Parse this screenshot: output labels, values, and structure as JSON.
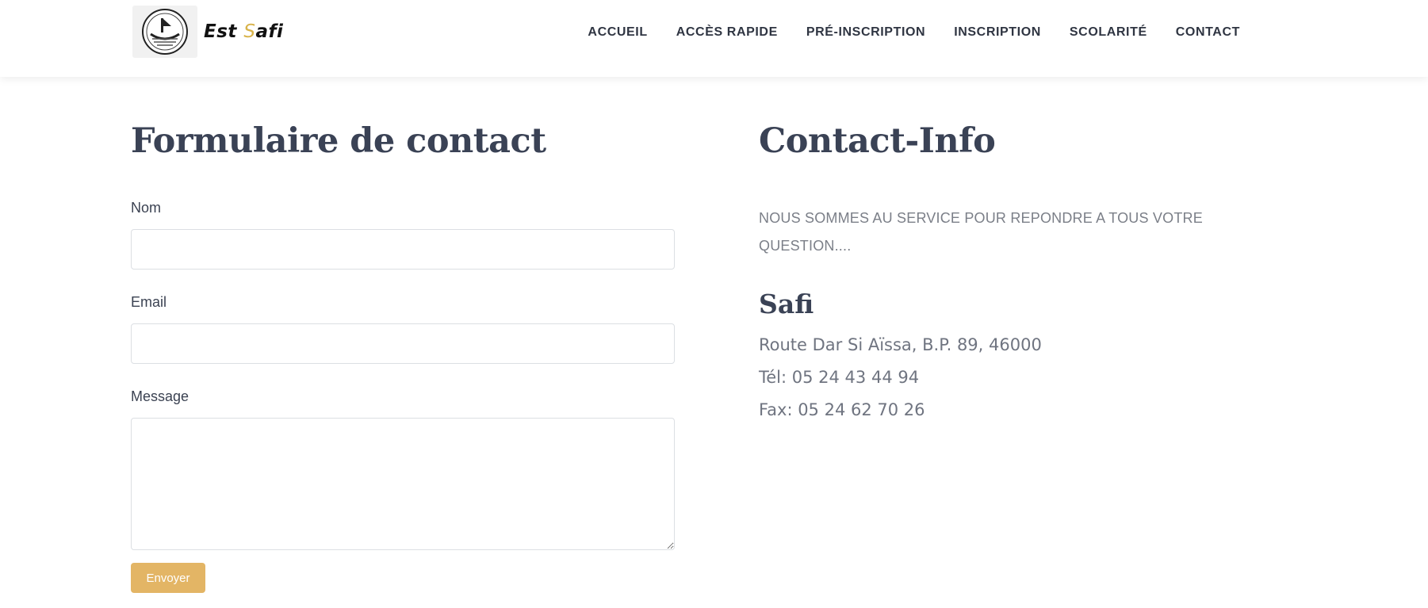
{
  "header": {
    "logo": {
      "text_main": "Est",
      "text_accent_initial": "S",
      "text_accent_rest": "afi"
    },
    "nav": [
      {
        "label": "ACCUEIL"
      },
      {
        "label": "ACCÈS RAPIDE"
      },
      {
        "label": "PRÉ-INSCRIPTION"
      },
      {
        "label": "INSCRIPTION"
      },
      {
        "label": "SCOLARITÉ"
      },
      {
        "label": "CONTACT"
      }
    ]
  },
  "form": {
    "title": "Formulaire de contact",
    "fields": {
      "name_label": "Nom",
      "email_label": "Email",
      "message_label": "Message"
    },
    "submit_label": "Envoyer"
  },
  "contact_info": {
    "title": "Contact-Info",
    "intro": "NOUS SOMMES AU SERVICE POUR REPONDRE A TOUS VOTRE QUESTION....",
    "city": "Safi",
    "address": "Route Dar Si Aïssa, B.P. 89, 46000",
    "phone": "Tél: 05 24 43 44 94",
    "fax": "Fax: 05 24 62 70 26"
  },
  "colors": {
    "accent": "#e3b565",
    "heading": "#3a4255",
    "muted_text": "#7b7f88",
    "logo_accent": "#d8b34a"
  }
}
